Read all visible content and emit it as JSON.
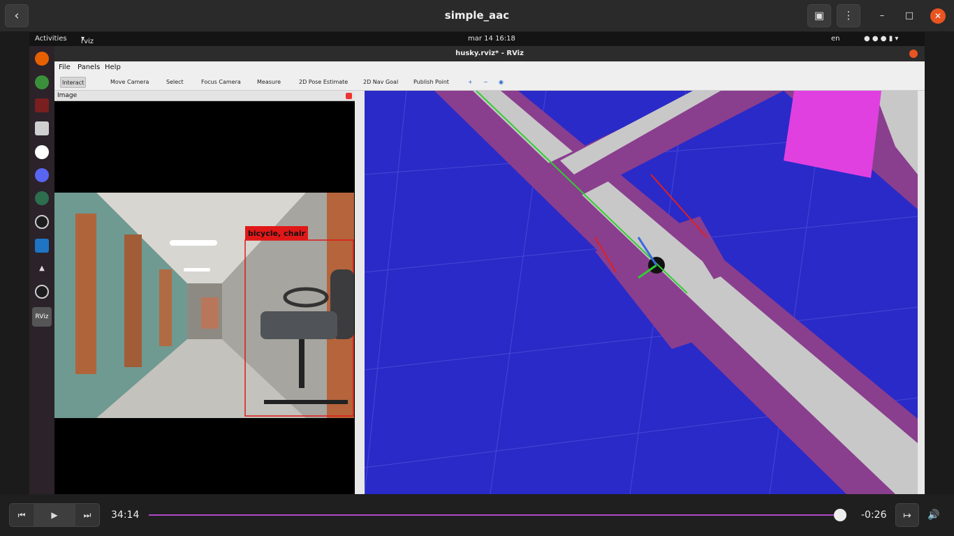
{
  "player": {
    "title": "simple_aac",
    "back_icon": "chevron-left-icon",
    "current_time": "34:14",
    "remaining_time": "-0:26",
    "progress": 0.99,
    "accent_color": "#b048c8"
  },
  "topbar": {
    "activities": "Activities",
    "app": "rviz",
    "datetime": "mar 14  16:18",
    "lang": "en"
  },
  "rviz": {
    "title": "husky.rviz* - RViz",
    "menu": [
      "File",
      "Panels",
      "Help"
    ],
    "tools": [
      "Interact",
      "Move Camera",
      "Select",
      "Focus Camera",
      "Measure",
      "2D Pose Estimate",
      "2D Nav Goal",
      "Publish Point"
    ],
    "panel_title": "Image",
    "detection_label": "bicycle, chair"
  }
}
